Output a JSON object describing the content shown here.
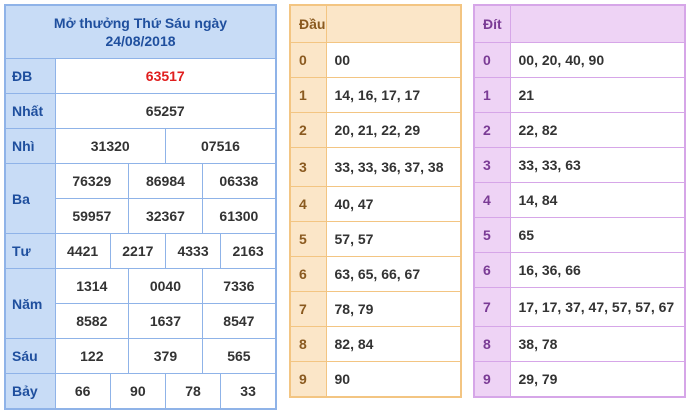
{
  "results": {
    "title_line1": "Mở thưởng Thứ Sáu ngày",
    "title_line2": "24/08/2018",
    "db": {
      "label": "ĐB",
      "values": [
        "63517"
      ]
    },
    "nhat": {
      "label": "Nhất",
      "values": [
        "65257"
      ]
    },
    "nhi": {
      "label": "Nhì",
      "values": [
        "31320",
        "07516"
      ]
    },
    "ba": {
      "label": "Ba",
      "values": [
        "76329",
        "86984",
        "06338",
        "59957",
        "32367",
        "61300"
      ]
    },
    "tu": {
      "label": "Tư",
      "values": [
        "4421",
        "2217",
        "4333",
        "2163"
      ]
    },
    "nam": {
      "label": "Năm",
      "values": [
        "1314",
        "0040",
        "7336",
        "8582",
        "1637",
        "8547"
      ]
    },
    "sau": {
      "label": "Sáu",
      "values": [
        "122",
        "379",
        "565"
      ]
    },
    "bay": {
      "label": "Bảy",
      "values": [
        "66",
        "90",
        "78",
        "33"
      ]
    }
  },
  "dau": {
    "header": "Đầu",
    "rows": [
      {
        "key": "0",
        "values": "00"
      },
      {
        "key": "1",
        "values": "14, 16, 17, 17"
      },
      {
        "key": "2",
        "values": "20, 21, 22, 29"
      },
      {
        "key": "3",
        "values": "33, 33, 36, 37, 38"
      },
      {
        "key": "4",
        "values": "40, 47"
      },
      {
        "key": "5",
        "values": "57, 57"
      },
      {
        "key": "6",
        "values": "63, 65, 66, 67"
      },
      {
        "key": "7",
        "values": "78, 79"
      },
      {
        "key": "8",
        "values": "82, 84"
      },
      {
        "key": "9",
        "values": "90"
      }
    ]
  },
  "dit": {
    "header": "Đít",
    "rows": [
      {
        "key": "0",
        "values": "00, 20, 40, 90"
      },
      {
        "key": "1",
        "values": "21"
      },
      {
        "key": "2",
        "values": "22, 82"
      },
      {
        "key": "3",
        "values": "33, 33, 63"
      },
      {
        "key": "4",
        "values": "14, 84"
      },
      {
        "key": "5",
        "values": "65"
      },
      {
        "key": "6",
        "values": "16, 36, 66"
      },
      {
        "key": "7",
        "values": "17, 17, 37, 47, 57, 57, 67"
      },
      {
        "key": "8",
        "values": "38, 78"
      },
      {
        "key": "9",
        "values": "29, 79"
      }
    ]
  }
}
